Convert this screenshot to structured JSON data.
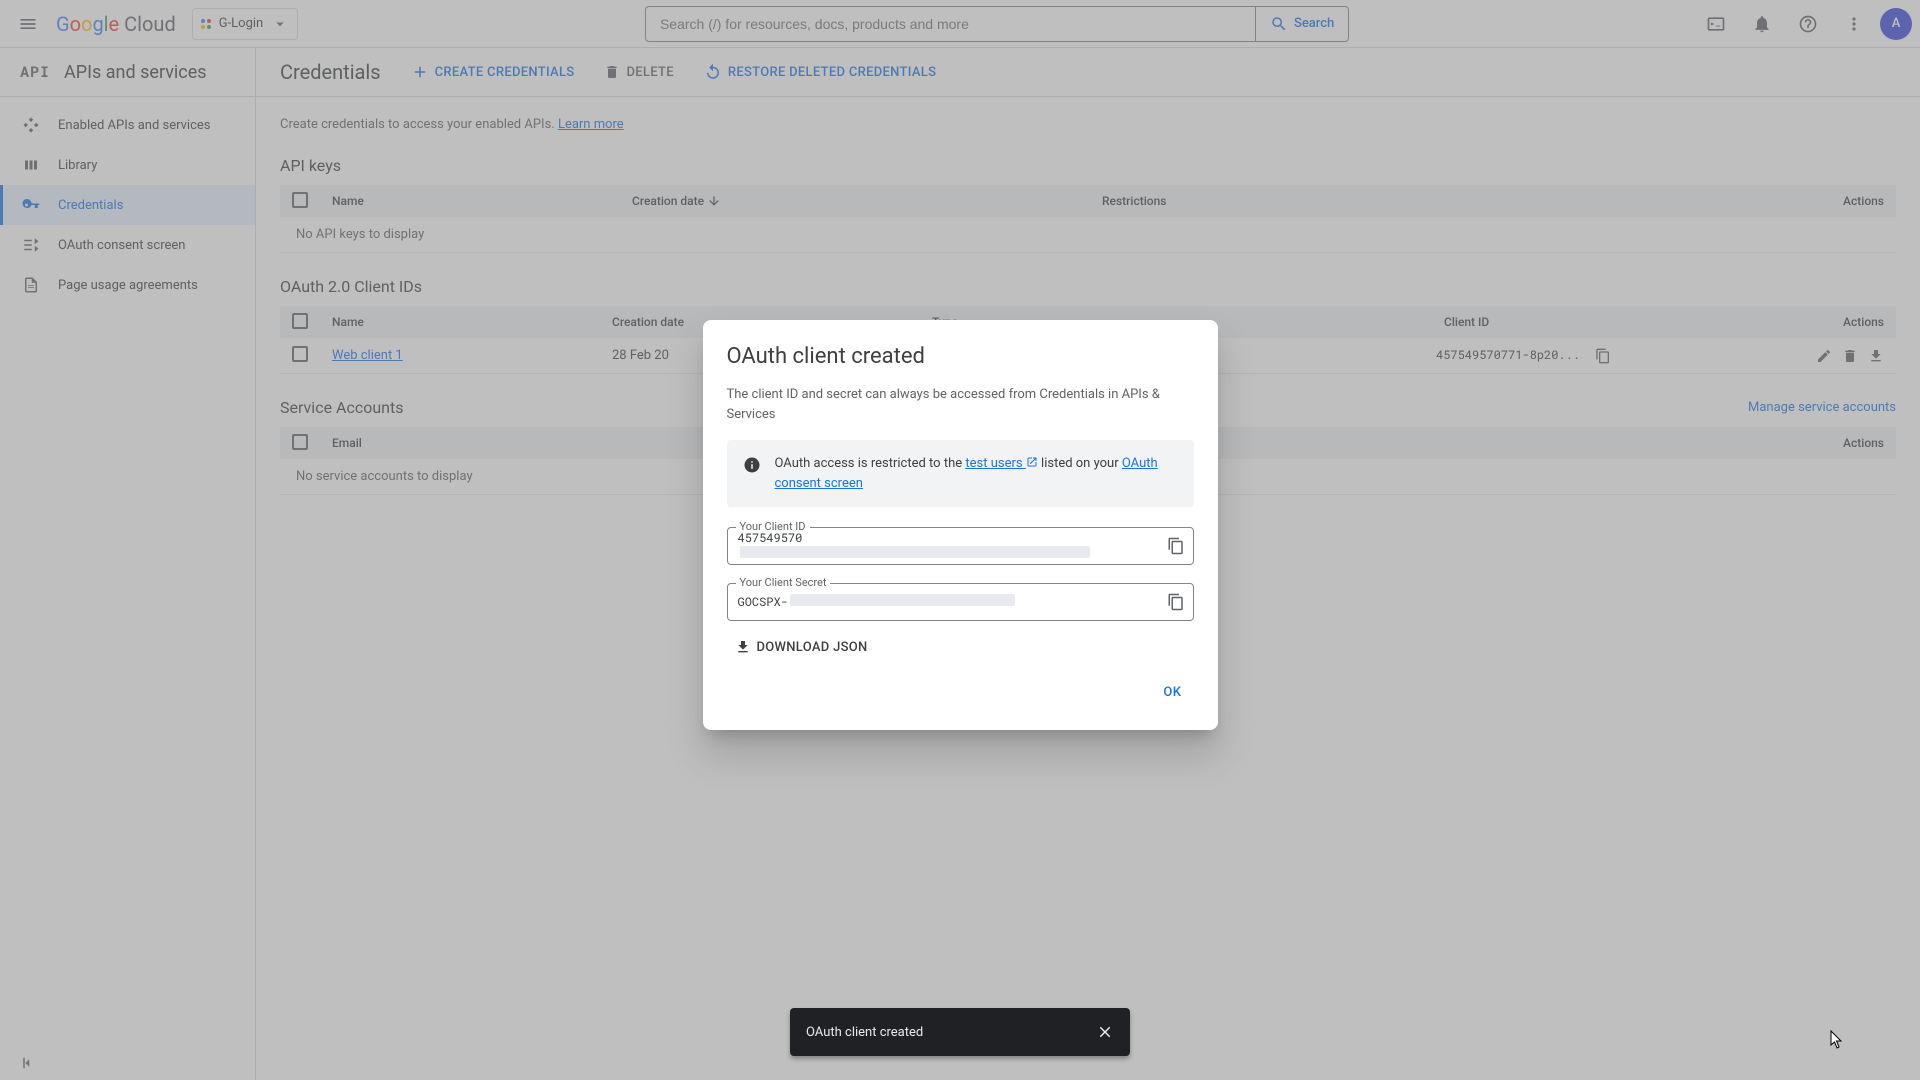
{
  "topbar": {
    "project_name": "G-Login",
    "search_placeholder": "Search (/) for resources, docs, products and more",
    "search_button": "Search",
    "avatar_letter": "A"
  },
  "sidebar": {
    "api_chip": "API",
    "title": "APIs and services",
    "items": [
      {
        "label": "Enabled APIs and services"
      },
      {
        "label": "Library"
      },
      {
        "label": "Credentials"
      },
      {
        "label": "OAuth consent screen"
      },
      {
        "label": "Page usage agreements"
      }
    ]
  },
  "header": {
    "title": "Credentials",
    "create": "CREATE CREDENTIALS",
    "delete": "DELETE",
    "restore": "RESTORE DELETED CREDENTIALS"
  },
  "hint": {
    "text": "Create credentials to access your enabled APIs. ",
    "link": "Learn more"
  },
  "api_keys": {
    "title": "API keys",
    "cols": {
      "name": "Name",
      "date": "Creation date",
      "restrict": "Restrictions",
      "actions": "Actions"
    },
    "empty": "No API keys to display"
  },
  "oauth": {
    "title": "OAuth 2.0 Client IDs",
    "cols": {
      "name": "Name",
      "date": "Creation date",
      "type": "Type",
      "clientid": "Client ID",
      "actions": "Actions"
    },
    "rows": [
      {
        "name": "Web client 1",
        "date": "28 Feb 20",
        "clientid": "457549570771-8p20..."
      }
    ]
  },
  "service": {
    "title": "Service Accounts",
    "manage": "Manage service accounts",
    "cols": {
      "email": "Email",
      "actions": "Actions"
    },
    "empty": "No service accounts to display"
  },
  "dialog": {
    "title": "OAuth client created",
    "subtitle": "The client ID and secret can always be accessed from Credentials in APIs & Services",
    "info_pre": "OAuth access is restricted to the ",
    "info_link1": "test users",
    "info_mid": " listed on your ",
    "info_link2": "OAuth consent screen",
    "client_id_label": "Your Client ID",
    "client_id_value": "457549570",
    "client_secret_label": "Your Client Secret",
    "client_secret_value": "GOCSPX-",
    "download": "DOWNLOAD JSON",
    "ok": "OK"
  },
  "toast": {
    "message": "OAuth client created"
  }
}
